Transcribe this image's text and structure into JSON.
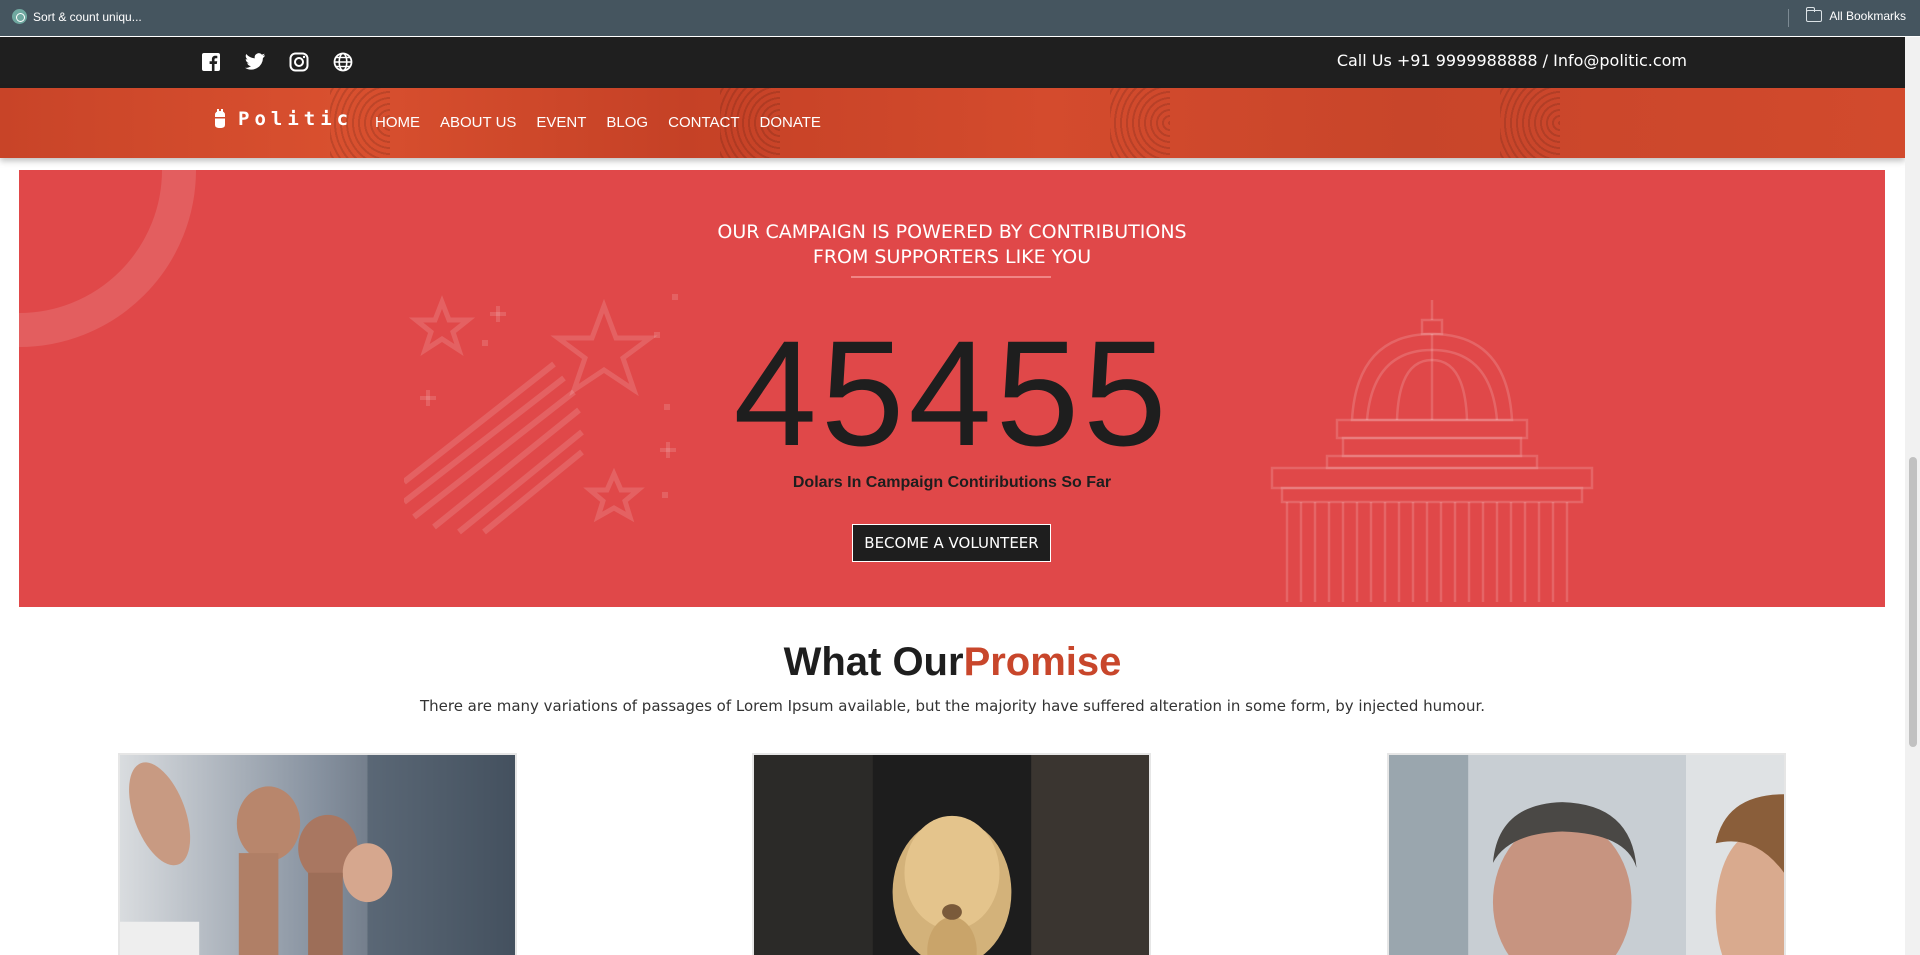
{
  "browser": {
    "bookmark_tab": "Sort & count uniqu...",
    "all_bookmarks": "All Bookmarks"
  },
  "topbar": {
    "social_icons": [
      "facebook-icon",
      "twitter-icon",
      "instagram-icon",
      "globe-icon"
    ],
    "contact": "Call Us +91 9999988888  /  Info@politic.com"
  },
  "nav": {
    "brand": "Politic",
    "items": [
      "HOME",
      "ABOUT US",
      "EVENT",
      "BLOG",
      "CONTACT",
      "DONATE"
    ]
  },
  "campaign": {
    "title_line1": "OUR CAMPAIGN IS POWERED BY CONTRIBUTIONS",
    "title_line2": "FROM SUPPORTERS LIKE YOU",
    "amount": "45455",
    "label": "Dolars In Campaign Contiributions So Far",
    "button": "BECOME A VOLUNTEER"
  },
  "promise": {
    "heading_part1": "What Our",
    "heading_part2": "Promise",
    "text": "There are many variations of passages of Lorem Ipsum available, but the majority have suffered alteration in some form, by injected humour."
  },
  "colors": {
    "banner": "#e04849",
    "accent": "#c8462b",
    "topbar": "#1f1f1f"
  }
}
